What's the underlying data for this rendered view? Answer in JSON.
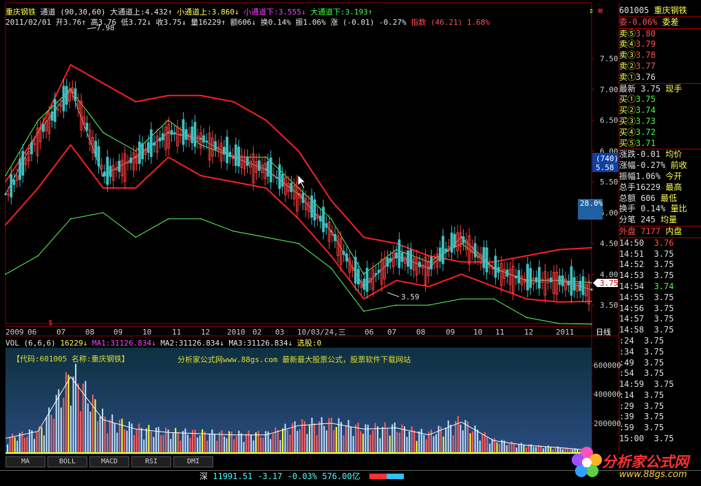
{
  "header": {
    "stock_name": "重庆钢铁",
    "indicator": "通道 (90,30,60)",
    "big_up_label": "大通道上:4.432↑",
    "small_up_label": "小通道上:3.860↓",
    "small_down_label": "小通道下:3.555↓",
    "big_down_label": "大通道下:3.193↑",
    "date": "2011/02/01",
    "open": "开3.76↑",
    "high": "高3.76",
    "low": "低3.72↓",
    "close": "收3.75↓",
    "volume": "量16229↑",
    "amount": "额606↓",
    "turnover": "换0.14%",
    "amplitude": "振1.06%",
    "change": "涨 (-0.01) -0.27%",
    "index": "指数 (46.21) 1.68%"
  },
  "price_axis": [
    "7.50",
    "7.00",
    "6.50",
    "6.00",
    "5.50",
    "5.00",
    "4.50",
    "4.00",
    "3.50"
  ],
  "annotations": {
    "peak": "7.98",
    "trough": "3.59",
    "cursor_price": "3.75",
    "box_top": "(740)",
    "box_bottom": "5.58",
    "pct_box": "28.0%"
  },
  "time_axis": [
    "2009",
    "06",
    "07",
    "08",
    "09",
    "10",
    "11",
    "12",
    "2010",
    "02",
    "03",
    "10/03/24,三",
    "06",
    "07",
    "08",
    "09",
    "10",
    "11",
    "12",
    "2011",
    "日线"
  ],
  "volume_panel": {
    "header": "VOL (6,6,6)",
    "vol": "16229↓",
    "ma1": "MA1:31126.834↓",
    "ma2": "MA2:31126.834↓",
    "ma3": "MA3:31126.834↓",
    "pick": "选股:0",
    "axis": [
      "600000",
      "400000",
      "200000"
    ],
    "watermark_code": "【代码:601005 名称:重庆钢铁】",
    "watermark_site": "分析家公式网www.88gs.com 最新最大股票公式，股票软件下载网站"
  },
  "tabs": [
    "MA",
    "BOLL",
    "MACD",
    "RSI",
    "DMI"
  ],
  "quote_panel": {
    "code": "601005",
    "name": "重庆钢铁",
    "ratio": "委-0.06%",
    "ratio_label": "委差",
    "sells": [
      {
        "l": "卖⑤",
        "p": "3.80"
      },
      {
        "l": "卖④",
        "p": "3.79"
      },
      {
        "l": "卖③",
        "p": "3.78"
      },
      {
        "l": "卖②",
        "p": "3.77"
      },
      {
        "l": "卖①",
        "p": "3.76"
      }
    ],
    "latest": "最新 3.75",
    "latest_tag": "现手",
    "buys": [
      {
        "l": "买①",
        "p": "3.75"
      },
      {
        "l": "买②",
        "p": "3.74"
      },
      {
        "l": "买③",
        "p": "3.73"
      },
      {
        "l": "买④",
        "p": "3.72"
      },
      {
        "l": "买⑤",
        "p": "3.71"
      }
    ],
    "stats": [
      {
        "a": "涨跌-0.01",
        "b": "均价"
      },
      {
        "a": "涨幅-0.27%",
        "b": "前收"
      },
      {
        "a": "振幅1.06%",
        "b": "今开"
      },
      {
        "a": "总手16229",
        "b": "最高"
      },
      {
        "a": "总额 606",
        "b": "最低"
      },
      {
        "a": "换手 0.14%",
        "b": "量比"
      },
      {
        "a": "分笔 245",
        "b": "均量"
      }
    ],
    "outer": "外盘 7177",
    "inner": "内盘",
    "ticks": [
      {
        "t": "14:50",
        "p": "3.76"
      },
      {
        "t": "14:51",
        "p": "3.75"
      },
      {
        "t": "14:52",
        "p": "3.75"
      },
      {
        "t": "14:53",
        "p": "3.75"
      },
      {
        "t": "14:54",
        "p": "3.74"
      },
      {
        "t": "14:55",
        "p": "3.75"
      },
      {
        "t": "14:56",
        "p": "3.75"
      },
      {
        "t": "14:57",
        "p": "3.75"
      },
      {
        "t": "14:58",
        "p": "3.75"
      },
      {
        "t": ":24",
        "p": "3.75"
      },
      {
        "t": ":34",
        "p": "3.75"
      },
      {
        "t": ":49",
        "p": "3.75"
      },
      {
        "t": ":54",
        "p": "3.75"
      },
      {
        "t": "14:59",
        "p": "3.75"
      },
      {
        "t": ":14",
        "p": "3.75"
      },
      {
        "t": ":29",
        "p": "3.75"
      },
      {
        "t": ":39",
        "p": "3.75"
      },
      {
        "t": ":59",
        "p": "3.75"
      },
      {
        "t": "15:00",
        "p": "3.75"
      }
    ]
  },
  "status_bar": {
    "market": "深",
    "value": "11991.51",
    "change": "-3.17",
    "pct": "-0.03%",
    "amount": "576.00亿"
  },
  "logo": {
    "text": "分析家公式网",
    "url": "www.88gs.com"
  },
  "chart_data": {
    "type": "line",
    "title": "",
    "xlabel": "",
    "ylabel": "",
    "ylim": [
      3.2,
      8.0
    ],
    "x": [
      "2009-05",
      "2009-07",
      "2009-08",
      "2009-09",
      "2009-10",
      "2009-12",
      "2010-01",
      "2010-02",
      "2010-03",
      "2010-04",
      "2010-05",
      "2010-07",
      "2010-08",
      "2010-09",
      "2010-10",
      "2010-11",
      "2010-12",
      "2011-01",
      "2011-02"
    ],
    "series": [
      {
        "name": "收",
        "values": [
          5.3,
          6.3,
          7.0,
          5.6,
          5.9,
          6.3,
          6.2,
          5.9,
          5.7,
          5.3,
          4.7,
          3.8,
          4.3,
          4.1,
          4.6,
          4.1,
          3.9,
          3.9,
          3.75
        ]
      },
      {
        "name": "大通道上",
        "values": [
          5.5,
          6.3,
          7.4,
          7.1,
          6.8,
          6.9,
          6.9,
          6.8,
          6.5,
          6.0,
          5.2,
          4.6,
          4.5,
          4.3,
          4.2,
          4.2,
          4.3,
          4.4,
          4.43
        ]
      },
      {
        "name": "小通道上",
        "values": [
          5.6,
          6.5,
          7.0,
          6.3,
          6.0,
          6.5,
          6.1,
          5.9,
          5.9,
          5.4,
          4.9,
          4.0,
          4.4,
          4.2,
          4.5,
          4.1,
          3.9,
          3.9,
          3.86
        ]
      },
      {
        "name": "小通道下",
        "values": [
          4.8,
          5.4,
          6.1,
          5.4,
          5.4,
          5.9,
          5.6,
          5.5,
          5.4,
          4.9,
          4.3,
          3.6,
          3.9,
          3.8,
          4.0,
          3.8,
          3.6,
          3.55,
          3.56
        ]
      },
      {
        "name": "大通道下",
        "values": [
          4.0,
          4.3,
          4.9,
          5.0,
          4.6,
          4.9,
          4.9,
          4.7,
          4.6,
          4.5,
          4.1,
          3.4,
          3.5,
          3.5,
          3.6,
          3.6,
          3.3,
          3.2,
          3.19
        ]
      }
    ],
    "volume_k": [
      120,
      180,
      650,
      280,
      200,
      170,
      160,
      150,
      150,
      230,
      250,
      200,
      210,
      150,
      260,
      100,
      60,
      40,
      16
    ]
  }
}
